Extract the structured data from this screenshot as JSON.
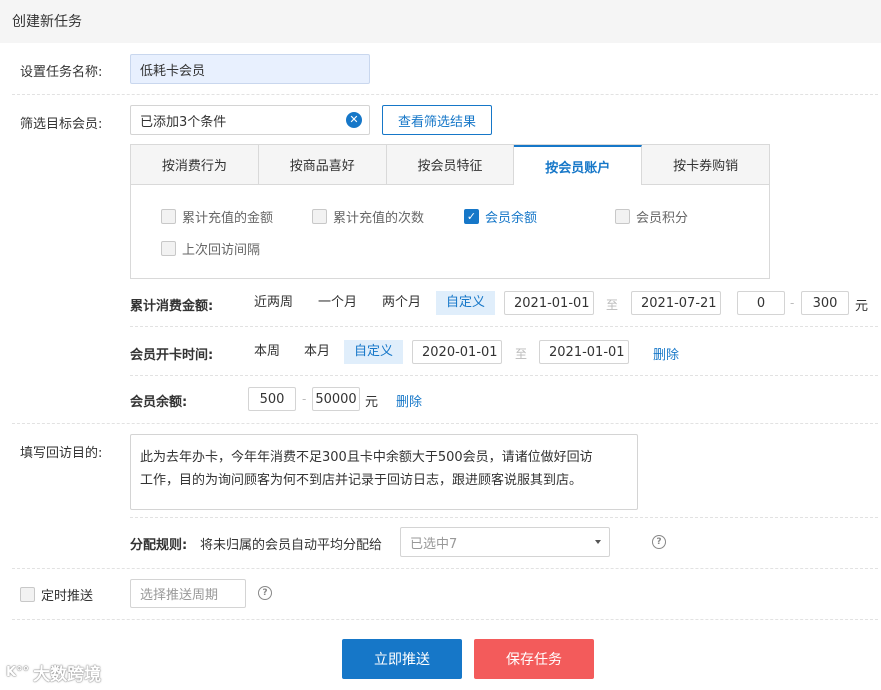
{
  "header": {
    "title": "创建新任务"
  },
  "task_name": {
    "label": "设置任务名称:",
    "value": "低耗卡会员"
  },
  "filter": {
    "label": "筛选目标会员:",
    "value": "已添加3个条件",
    "clear_icon": "close-circle-icon",
    "view_results": "查看筛选结果"
  },
  "tabs": [
    "按消费行为",
    "按商品喜好",
    "按会员特征",
    "按会员账户",
    "按卡券购销"
  ],
  "active_tab": "按会员账户",
  "checkboxes": [
    {
      "label": "累计充值的金额",
      "checked": false
    },
    {
      "label": "累计充值的次数",
      "checked": false
    },
    {
      "label": "会员余额",
      "checked": true
    },
    {
      "label": "会员积分",
      "checked": false
    },
    {
      "label": "上次回访间隔",
      "checked": false
    }
  ],
  "conditions": {
    "spend": {
      "label": "累计消费金额:",
      "options": [
        "近两周",
        "一个月",
        "两个月",
        "自定义"
      ],
      "active": "自定义",
      "date_from": "2021-01-01",
      "to": "至",
      "date_to": "2021-07-21",
      "min": "0",
      "dash": "-",
      "max": "300",
      "unit": "元"
    },
    "open_card": {
      "label": "会员开卡时间:",
      "options": [
        "本周",
        "本月",
        "自定义"
      ],
      "active": "自定义",
      "date_from": "2020-01-01",
      "to": "至",
      "date_to": "2021-01-01",
      "delete": "删除"
    },
    "balance": {
      "label": "会员余额:",
      "min": "500",
      "dash": "-",
      "max": "50000",
      "unit": "元",
      "delete": "删除"
    }
  },
  "purpose": {
    "label": "填写回访目的:",
    "line1": "此为去年办卡，今年年消费不足300且卡中余额大于500会员，请诸位做好回访",
    "line2": "工作，目的为询问顾客为何不到店并记录于回访日志，跟进顾客说服其到店。"
  },
  "assign": {
    "label": "分配规则:",
    "text": "将未归属的会员自动平均分配给",
    "select_value": "已选中7",
    "help_icon": "question-circle-icon"
  },
  "schedule": {
    "label": "定时推送",
    "placeholder": "选择推送周期",
    "help_icon": "question-circle-icon"
  },
  "buttons": {
    "push_now": "立即推送",
    "save": "保存任务"
  },
  "watermark": "大数跨境",
  "colors": {
    "primary": "#1677c8",
    "danger": "#f35b5b",
    "header_bg": "#f5f5f5"
  }
}
